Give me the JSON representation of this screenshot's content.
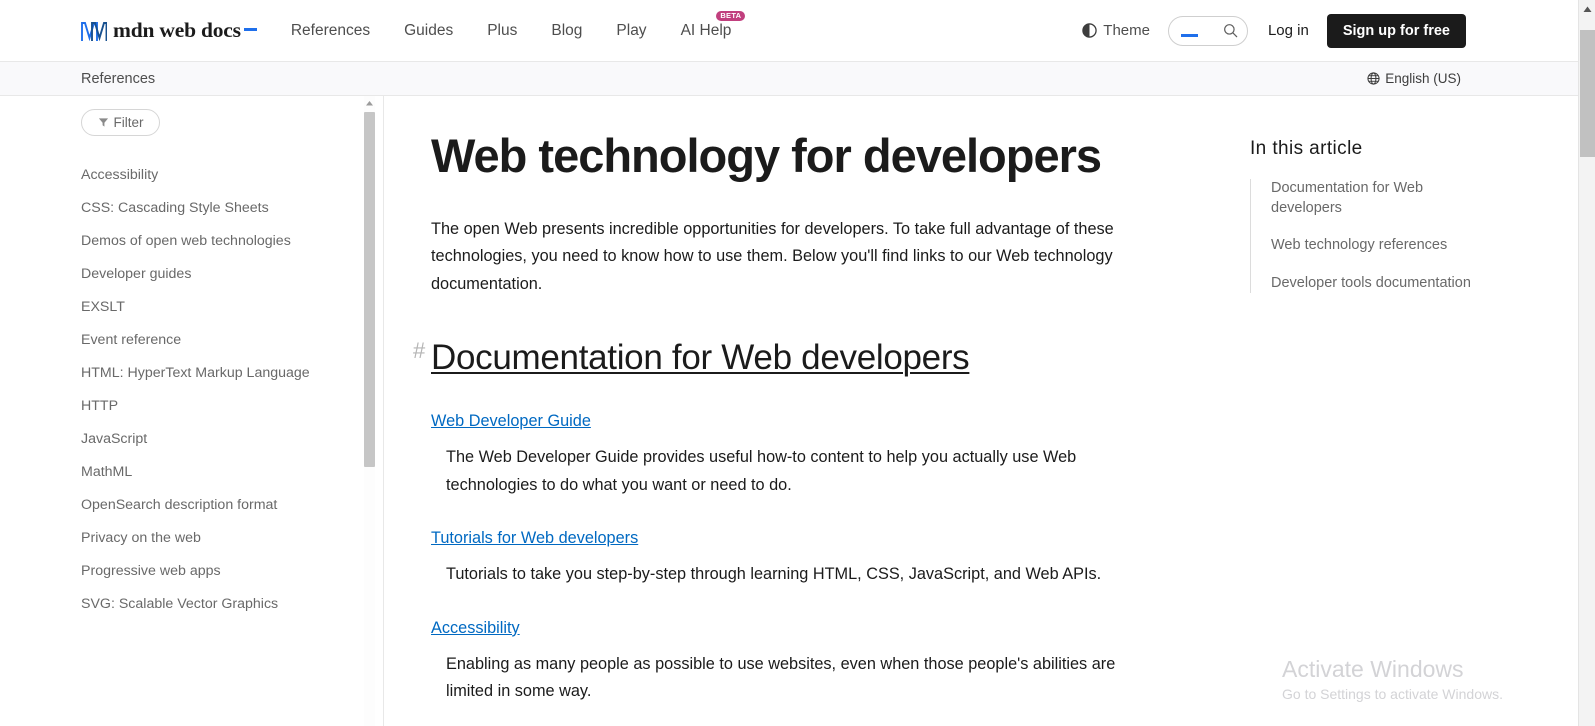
{
  "header": {
    "logo_text": "mdn web docs",
    "logo_icon": "mdn-m-logo",
    "nav": [
      {
        "label": "References",
        "badge": null
      },
      {
        "label": "Guides",
        "badge": null
      },
      {
        "label": "Plus",
        "badge": null
      },
      {
        "label": "Blog",
        "badge": null
      },
      {
        "label": "Play",
        "badge": null
      },
      {
        "label": "AI Help",
        "badge": "BETA"
      }
    ],
    "theme_label": "Theme",
    "theme_icon": "contrast-icon",
    "search_icon": "search-icon",
    "search_value": "",
    "search_placeholder": "",
    "login_label": "Log in",
    "signup_label": "Sign up for free"
  },
  "breadcrumb": {
    "label": "References",
    "language_label": "English (US)",
    "language_icon": "globe-icon"
  },
  "sidebar": {
    "filter_label": "Filter",
    "filter_icon": "funnel-icon",
    "items": [
      {
        "label": "Accessibility"
      },
      {
        "label": "CSS: Cascading Style Sheets"
      },
      {
        "label": "Demos of open web technologies"
      },
      {
        "label": "Developer guides"
      },
      {
        "label": "EXSLT"
      },
      {
        "label": "Event reference"
      },
      {
        "label": "HTML: HyperText Markup Language"
      },
      {
        "label": "HTTP"
      },
      {
        "label": "JavaScript"
      },
      {
        "label": "MathML"
      },
      {
        "label": "OpenSearch description format"
      },
      {
        "label": "Privacy on the web"
      },
      {
        "label": "Progressive web apps"
      },
      {
        "label": "SVG: Scalable Vector Graphics"
      }
    ]
  },
  "article": {
    "title": "Web technology for developers",
    "intro": "The open Web presents incredible opportunities for developers. To take full advantage of these technologies, you need to know how to use them. Below you'll find links to our Web technology documentation.",
    "section_anchor": "#",
    "section_heading": "Documentation for Web developers",
    "entries": [
      {
        "term": "Web Developer Guide",
        "description": "The Web Developer Guide provides useful how-to content to help you actually use Web technologies to do what you want or need to do."
      },
      {
        "term": "Tutorials for Web developers",
        "description": "Tutorials to take you step-by-step through learning HTML, CSS, JavaScript, and Web APIs."
      },
      {
        "term": "Accessibility",
        "description": "Enabling as many people as possible to use websites, even when those people's abilities are limited in some way."
      }
    ]
  },
  "toc": {
    "title": "In this article",
    "items": [
      {
        "label": "Documentation for Web developers"
      },
      {
        "label": "Web technology references"
      },
      {
        "label": "Developer tools documentation"
      }
    ]
  },
  "watermark": {
    "title": "Activate Windows",
    "subtitle": "Go to Settings to activate Windows."
  },
  "colors": {
    "link": "#0069c2",
    "accent_blue": "#1f6feb",
    "beta_badge": "#c13f7e",
    "signup_bg": "#1b1b1b",
    "text": "#1b1b1b",
    "muted": "#696969"
  }
}
